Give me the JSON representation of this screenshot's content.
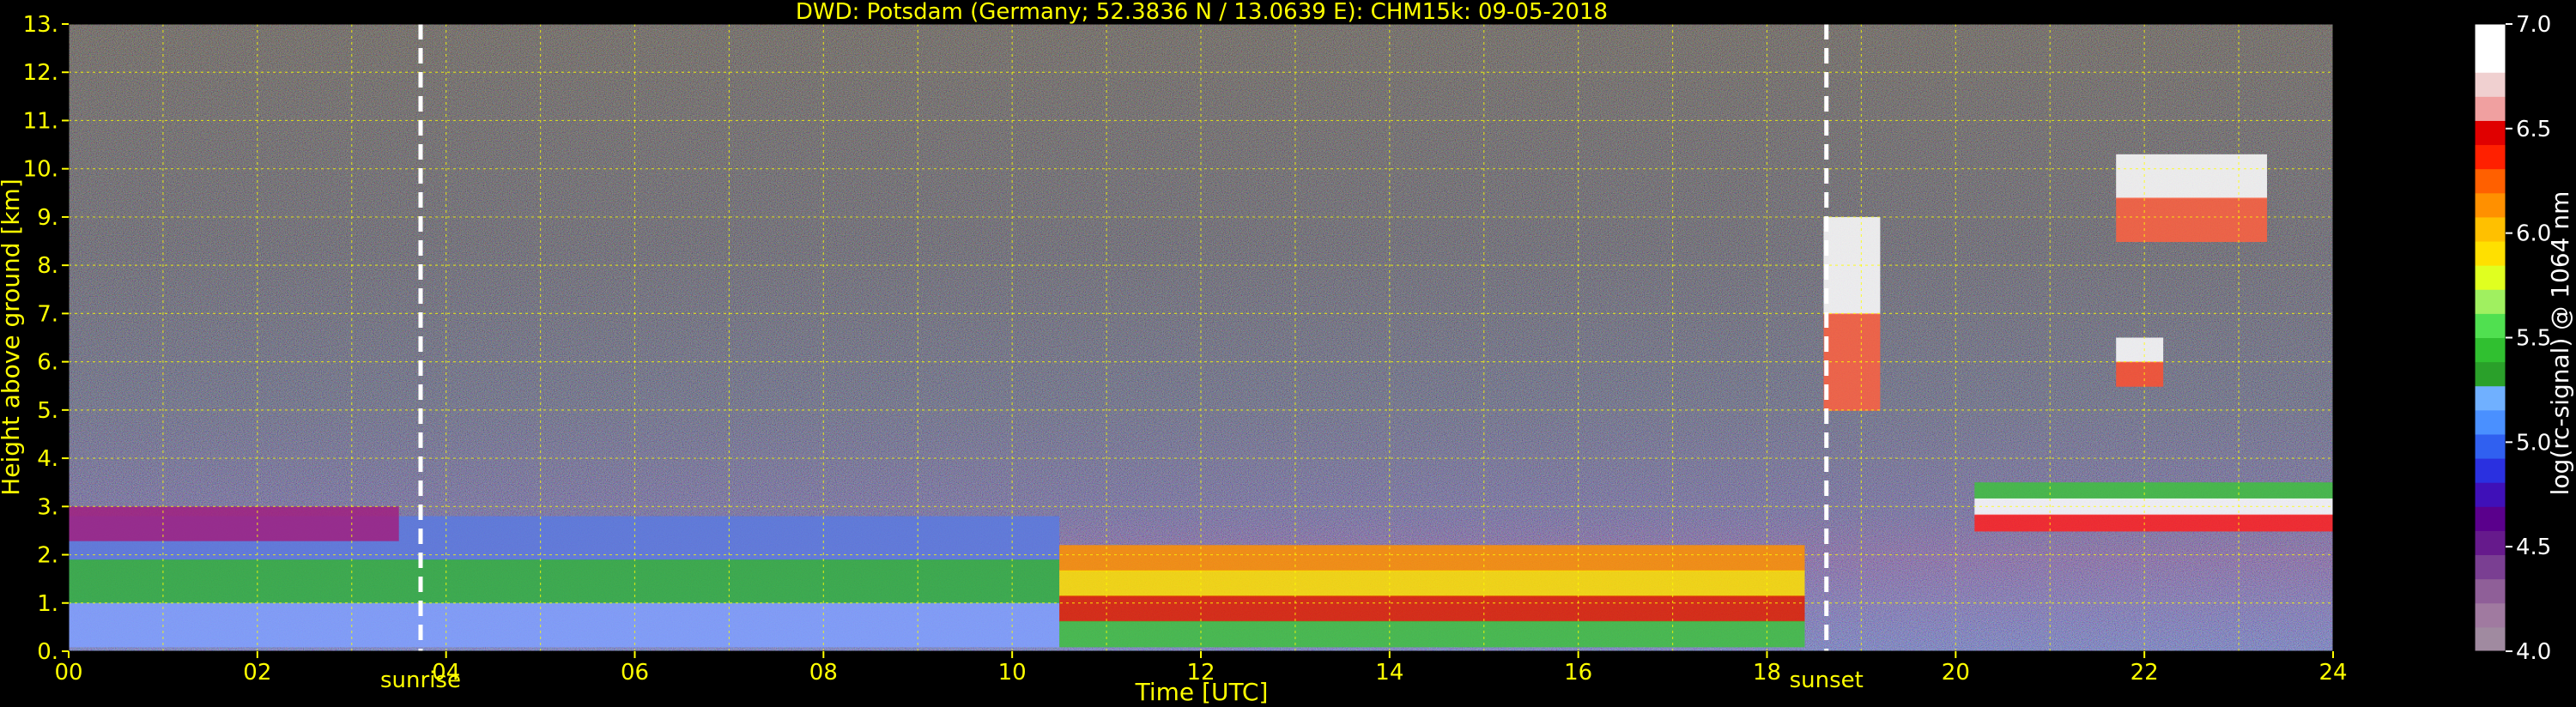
{
  "chart_data": {
    "type": "heatmap",
    "title": "DWD: Potsdam (Germany; 52.3836 N / 13.0639 E):    CHM15k: 09-05-2018",
    "xlabel": "Time [UTC]",
    "ylabel": "Height above ground [km]",
    "xlim": [
      0,
      24
    ],
    "ylim": [
      0,
      13
    ],
    "x_ticks": [
      "00",
      "02",
      "04",
      "06",
      "08",
      "10",
      "12",
      "14",
      "16",
      "18",
      "20",
      "22",
      "24"
    ],
    "y_ticks": [
      "0.",
      "1.",
      "2.",
      "3.",
      "4.",
      "5.",
      "6.",
      "7.",
      "8.",
      "9.",
      "10.",
      "11.",
      "12.",
      "13."
    ],
    "grid": true,
    "grid_color": "#ffff00",
    "markers": [
      {
        "name": "sunrise",
        "time": 3.73
      },
      {
        "name": "sunset",
        "time": 18.63
      }
    ],
    "colorbar": {
      "label": "log(rc-signal) @ 1064 nm",
      "range": [
        4.0,
        7.0
      ],
      "ticks": [
        "4.0",
        "4.5",
        "5.0",
        "5.5",
        "6.0",
        "6.5",
        "7.0"
      ],
      "colors": [
        "#a08aa0",
        "#a07aa0",
        "#8f5f98",
        "#7a3f92",
        "#661a8c",
        "#5a008c",
        "#3f10b8",
        "#2a30e0",
        "#3060f0",
        "#4a90ff",
        "#70b0ff",
        "#2aa02a",
        "#30c030",
        "#50e050",
        "#a0f060",
        "#e0ff20",
        "#ffe000",
        "#ffc000",
        "#ff9000",
        "#ff6000",
        "#ff2000",
        "#e00000",
        "#f0a0a0",
        "#f0d0d0",
        "#ffffff",
        "#ffffff"
      ]
    },
    "features": [
      {
        "kind": "boundary_layer",
        "t0": 0,
        "t1": 10.5,
        "h0": 0.1,
        "h1": 2.8
      },
      {
        "kind": "residual_layer",
        "t0": 0,
        "t1": 3.5,
        "h0": 2.3,
        "h1": 3.0
      },
      {
        "kind": "convective_layer",
        "t0": 10.5,
        "t1": 18.4,
        "h0": 0.1,
        "h1": 2.2
      },
      {
        "kind": "cirrus_cloud",
        "t0": 18.6,
        "t1": 19.2,
        "h0": 5.0,
        "h1": 9.0
      },
      {
        "kind": "cirrus_cloud",
        "t0": 21.7,
        "t1": 23.3,
        "h0": 8.5,
        "h1": 10.3
      },
      {
        "kind": "cloud",
        "t0": 21.7,
        "t1": 22.2,
        "h0": 5.5,
        "h1": 6.5
      },
      {
        "kind": "cloud_base",
        "t0": 20.2,
        "t1": 24,
        "h0": 2.5,
        "h1": 3.5
      }
    ]
  }
}
